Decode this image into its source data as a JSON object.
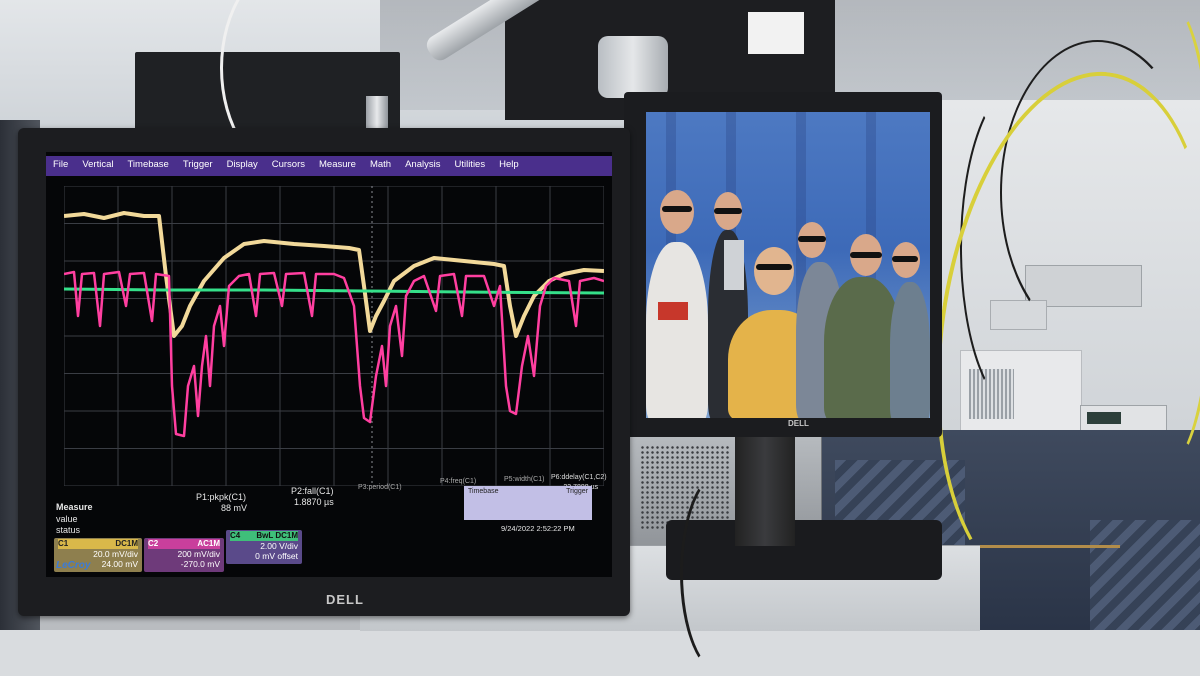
{
  "scope": {
    "menu": [
      "File",
      "Vertical",
      "Timebase",
      "Trigger",
      "Display",
      "Cursors",
      "Measure",
      "Math",
      "Analysis",
      "Utilities",
      "Help"
    ],
    "channel_markers": [
      "C1",
      "C4",
      "C2"
    ],
    "measure": {
      "title": "Measure",
      "row_value": "value",
      "row_status": "status",
      "p1_label": "P1:pkpk(C1)",
      "p1_value": "88 mV",
      "p2_label": "P2:fall(C1)",
      "p2_value": "1.8870 µs",
      "p3_label": "P3:period(C1)",
      "p4_label": "P4:freq(C1)",
      "p5_label": "P5:width(C1)",
      "p6_label": "P6:ddelay(C1,C2)",
      "p6_value": "-23.7888 µs"
    },
    "channels": [
      {
        "name": "C1",
        "tag": "DC1M",
        "line1": "20.0 mV/div",
        "line2": "24.00 mV",
        "color": "#d9b84a"
      },
      {
        "name": "C2",
        "tag": "AC1M",
        "line1": "200 mV/div",
        "line2": "-270.0 mV",
        "color": "#c93f9c"
      },
      {
        "name": "C4",
        "tag": "BwL DC1M",
        "line1": "2.00 V/div",
        "line2": "0 mV offset",
        "color": "#3fbf7a"
      }
    ],
    "timebase_label": "Timebase",
    "trigger_label": "Trigger",
    "datetime": "9/24/2022 2:52:22 PM",
    "brand": "LeCroy",
    "colors": {
      "trace_c1": "#f2d99a",
      "trace_c2": "#ff3fa0",
      "trace_c4": "#35e08a",
      "menubar": "#4a2f8c"
    }
  },
  "monitors": {
    "left_brand": "DELL",
    "right_brand": "DELL"
  }
}
